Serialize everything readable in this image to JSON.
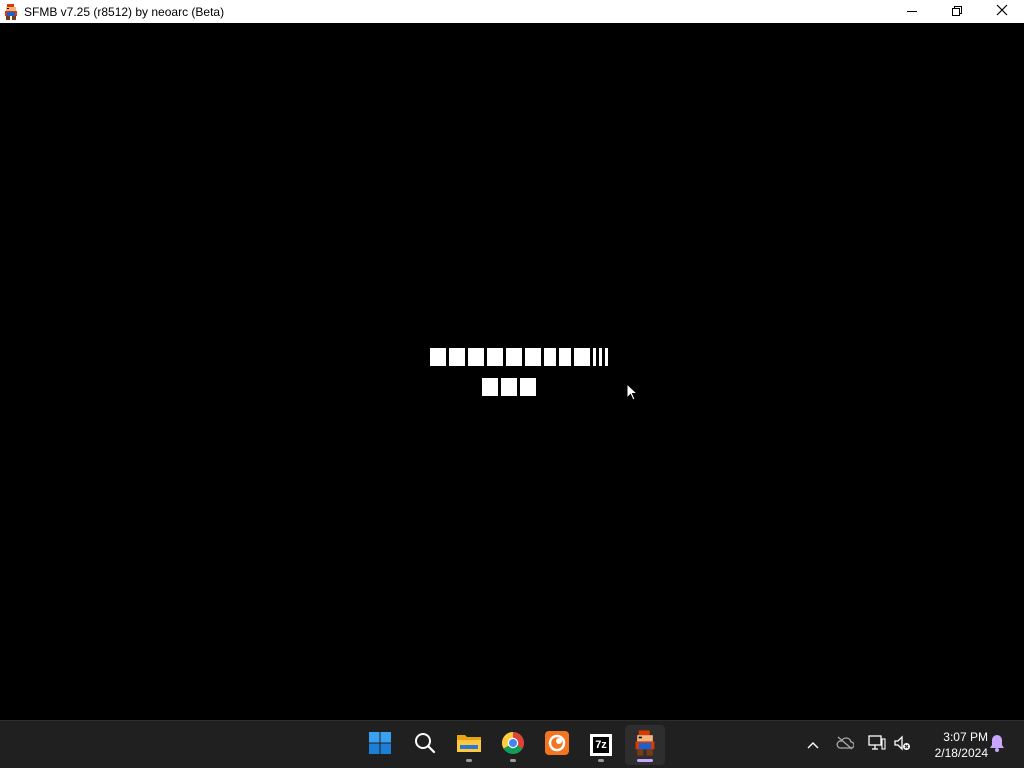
{
  "window": {
    "title": "SFMB v7.25 (r8512) by neoarc (Beta)",
    "app_icon": "mario-icon",
    "controls": [
      "minimize-icon",
      "restore-icon",
      "close-icon"
    ]
  },
  "game": {
    "text_line_1_glyph_count": 14,
    "text_line_2_glyph_count": 3,
    "text_color": "#ffffff",
    "background": "#000000"
  },
  "taskbar": {
    "apps": [
      {
        "name": "Start",
        "icon": "windows-start-icon"
      },
      {
        "name": "Search",
        "icon": "search-icon"
      },
      {
        "name": "File Explorer",
        "icon": "folder-icon"
      },
      {
        "name": "Google Chrome",
        "icon": "chrome-icon"
      },
      {
        "name": "Crunchyroll",
        "icon": "crunchyroll-icon"
      },
      {
        "name": "7-Zip",
        "icon": "7zip-icon",
        "label": "7z"
      },
      {
        "name": "SFMB",
        "icon": "mario-icon"
      }
    ],
    "tray": [
      "chevron-up-icon",
      "onedrive-icon",
      "network-icon",
      "volume-muted-icon"
    ],
    "clock": {
      "time": "3:07 PM",
      "date": "2/18/2024"
    },
    "notification_icon": "bell-icon",
    "accent": "#c8a5ff"
  }
}
